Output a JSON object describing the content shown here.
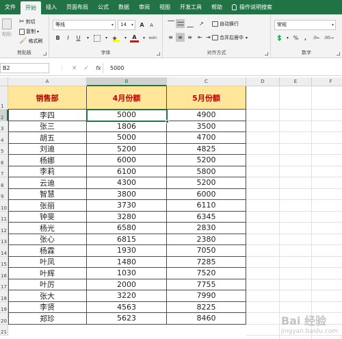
{
  "tabs": [
    "文件",
    "开始",
    "插入",
    "页面布局",
    "公式",
    "数据",
    "审阅",
    "视图",
    "开发工具",
    "帮助"
  ],
  "active_tab": "开始",
  "tell_me": "操作说明搜索",
  "ribbon": {
    "clipboard": {
      "paste": "粘贴",
      "cut": "剪切",
      "copy": "复制",
      "format_painter": "格式刷",
      "label": "剪贴板"
    },
    "font": {
      "name": "等线",
      "size": "14",
      "bold": "B",
      "italic": "I",
      "underline": "U",
      "font_color_glyph": "A",
      "grow": "A",
      "shrink": "A",
      "wen": "wén",
      "label": "字体"
    },
    "align": {
      "wrap": "自动换行",
      "merge": "合并后居中",
      "label": "对齐方式"
    },
    "number": {
      "format": "常规",
      "percent": "%",
      "comma": ",",
      "label": "数字"
    }
  },
  "formula_bar": {
    "name_box": "B2",
    "value": "5000",
    "fx": "fx"
  },
  "columns": [
    "A",
    "B",
    "C",
    "D",
    "E",
    "F"
  ],
  "selected_cell": {
    "col": "B",
    "row": 2
  },
  "headers": [
    "销售部",
    "4月份额",
    "5月份额"
  ],
  "rows": [
    [
      "李四",
      "5000",
      "4900"
    ],
    [
      "张三",
      "1806",
      "3500"
    ],
    [
      "胡五",
      "5000",
      "4700"
    ],
    [
      "刘迪",
      "5200",
      "4825"
    ],
    [
      "杨娜",
      "6000",
      "5200"
    ],
    [
      "李莉",
      "6100",
      "5800"
    ],
    [
      "云迪",
      "4300",
      "5200"
    ],
    [
      "智慧",
      "3800",
      "6000"
    ],
    [
      "张丽",
      "3730",
      "6110"
    ],
    [
      "钟斐",
      "3280",
      "6345"
    ],
    [
      "杨光",
      "6580",
      "2830"
    ],
    [
      "张心",
      "6815",
      "2380"
    ],
    [
      "杨霖",
      "1930",
      "7050"
    ],
    [
      "叶凤",
      "1480",
      "7285"
    ],
    [
      "叶辉",
      "1030",
      "7520"
    ],
    [
      "叶厉",
      "2000",
      "7755"
    ],
    [
      "张大",
      "3220",
      "7990"
    ],
    [
      "李贤",
      "4563",
      "8225"
    ],
    [
      "郑珍",
      "5623",
      "8460"
    ]
  ],
  "row_numbers": [
    "1",
    "2",
    "3",
    "4",
    "5",
    "6",
    "7",
    "8",
    "9",
    "10",
    "11",
    "12",
    "13",
    "14",
    "15",
    "16",
    "17",
    "18",
    "19",
    "20",
    "21"
  ],
  "watermark": {
    "text": "Bai 经验",
    "sub": "jingyan.baidu.com"
  },
  "colors": {
    "excel_green": "#217346",
    "header_fill": "#ffe699",
    "header_text": "#c00000"
  }
}
